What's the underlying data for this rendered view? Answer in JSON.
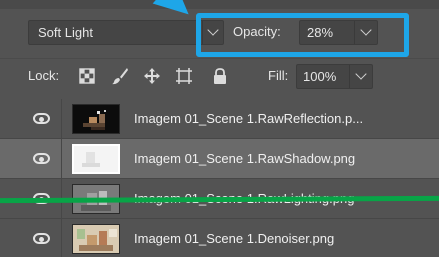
{
  "blend": {
    "mode": "Soft Light"
  },
  "opacity": {
    "label": "Opacity:",
    "value": "28%"
  },
  "lock": {
    "label": "Lock:",
    "icons": [
      "lock-transparent-pixels-icon",
      "lock-image-pixels-icon",
      "lock-position-icon",
      "lock-artboard-icon",
      "lock-all-icon"
    ]
  },
  "fill": {
    "label": "Fill:",
    "value": "100%"
  },
  "layers": [
    {
      "name": "Imagem 01_Scene 1.RawReflection.p...",
      "visible": true,
      "selected": false
    },
    {
      "name": "Imagem 01_Scene 1.RawShadow.png",
      "visible": true,
      "selected": true
    },
    {
      "name": "Imagem 01_Scene 1.RawLighting.png",
      "visible": true,
      "selected": false
    },
    {
      "name": "Imagem 01_Scene 1.Denoiser.png",
      "visible": true,
      "selected": false
    }
  ],
  "colors": {
    "highlight": "#1ea6e8",
    "strike_line": "#08a447",
    "panel_bg": "#535353",
    "selected_row": "#6a6a6a"
  }
}
